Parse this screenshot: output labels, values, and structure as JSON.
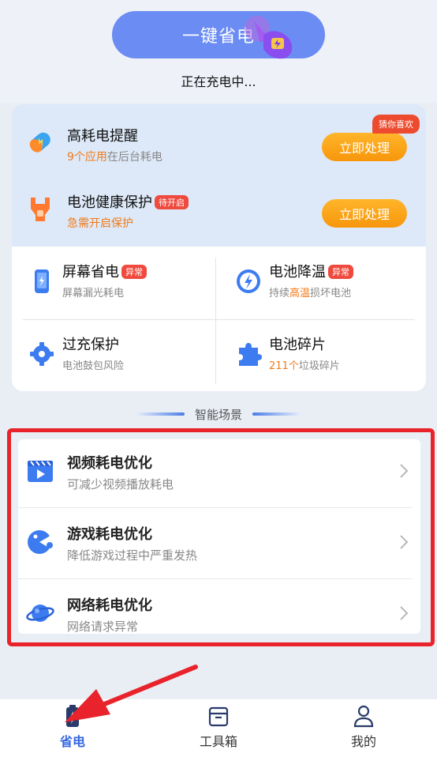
{
  "header": {
    "save_button_label": "一键省电",
    "status_text": "正在充电中..."
  },
  "alerts": [
    {
      "title": "高耗电提醒",
      "sub_highlight": "9个应用",
      "sub_rest": "在后台耗电",
      "button": "立即处理",
      "badge": "猜你喜欢",
      "icon": "battery-capsule-icon"
    },
    {
      "title": "电池健康保护",
      "pill": "待开启",
      "sub": "急需开启保护",
      "button": "立即处理",
      "icon": "wrench-shield-icon"
    }
  ],
  "grid": [
    {
      "title": "屏幕省电",
      "pill": "异常",
      "sub": "屏幕漏光耗电",
      "icon": "phone-screen-icon"
    },
    {
      "title": "电池降温",
      "pill": "异常",
      "sub_a": "持续",
      "sub_b": "高温",
      "sub_c": "损坏电池",
      "icon": "lightning-circle-icon"
    },
    {
      "title": "过充保护",
      "sub": "电池鼓包风险",
      "icon": "gear-shield-icon"
    },
    {
      "title": "电池碎片",
      "sub_highlight": "211个",
      "sub_rest": "垃圾碎片",
      "icon": "puzzle-icon"
    }
  ],
  "section": {
    "title": "智能场景"
  },
  "scenes": [
    {
      "title": "视频耗电优化",
      "sub": "可减少视频播放耗电",
      "icon": "video-icon"
    },
    {
      "title": "游戏耗电优化",
      "sub": "降低游戏过程中严重发热",
      "icon": "gamepad-icon"
    },
    {
      "title": "网络耗电优化",
      "sub": "网络请求异常",
      "icon": "planet-icon"
    }
  ],
  "tabs": [
    {
      "label": "省电",
      "active": true,
      "icon": "battery-tab-icon"
    },
    {
      "label": "工具箱",
      "active": false,
      "icon": "toolbox-tab-icon"
    },
    {
      "label": "我的",
      "active": false,
      "icon": "person-tab-icon"
    }
  ],
  "colors": {
    "accent_blue": "#3466e0",
    "button_blue": "#6b8cf2",
    "orange": "#f07a1a",
    "alert_red": "#ef4a3d",
    "highlight_red": "#e8232c"
  }
}
